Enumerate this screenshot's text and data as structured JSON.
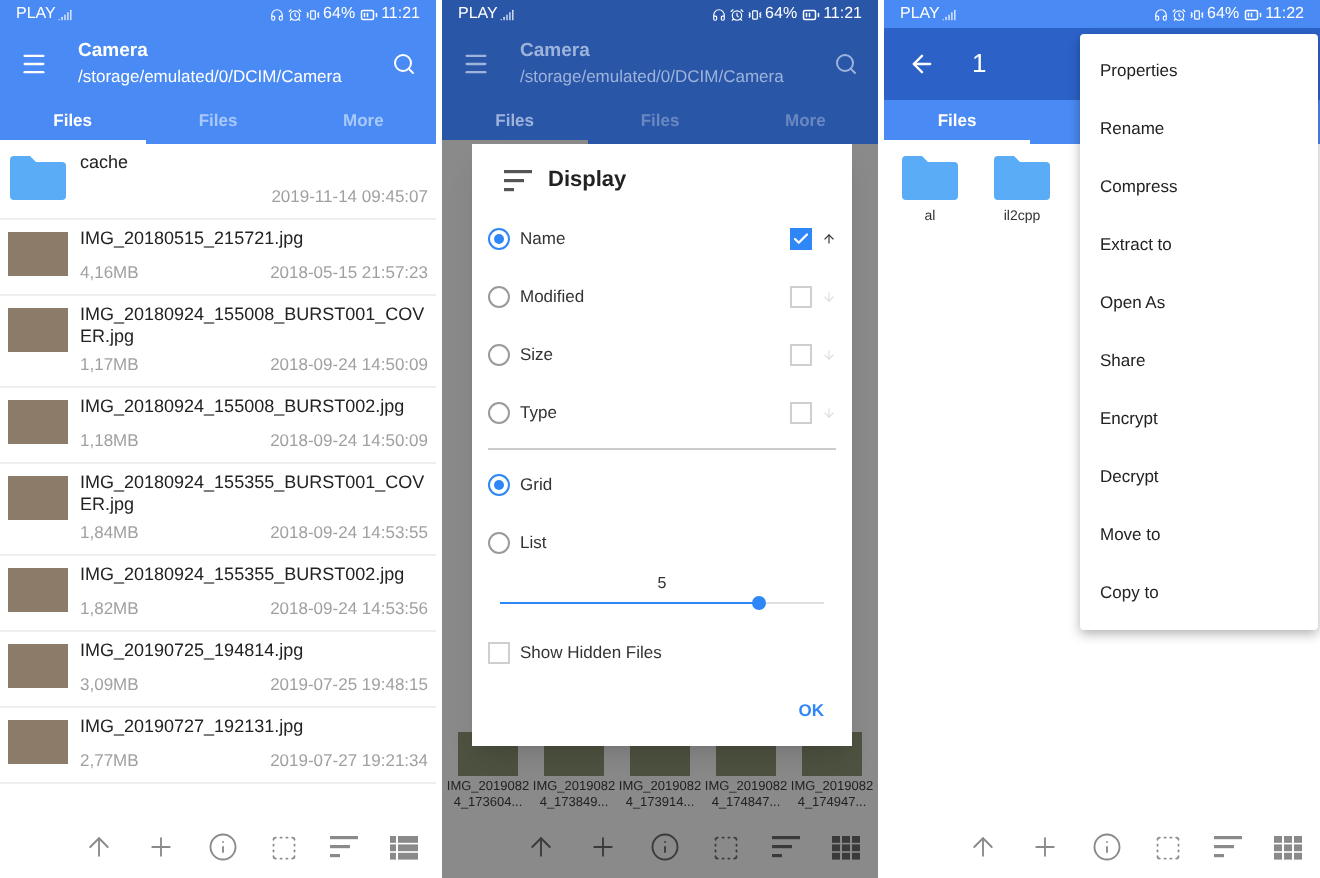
{
  "panels": [
    {
      "kind": "browser",
      "status_bar": {
        "carrier": "PLAY",
        "battery": "64%",
        "time": "11:21"
      },
      "header": {
        "kind": "browse",
        "title": "Camera",
        "path": "/storage/emulated/0/DCIM/Camera"
      },
      "tabs": [
        {
          "label": "Files",
          "selected": true
        },
        {
          "label": "Files",
          "selected": false
        },
        {
          "label": "More",
          "selected": false
        }
      ],
      "files": [
        {
          "kind": "folder",
          "name": "cache",
          "date": "2019-11-14 09:45:07"
        },
        {
          "kind": "image",
          "name": "IMG_20180515_215721.jpg",
          "size": "4,16MB",
          "date": "2018-05-15 21:57:23"
        },
        {
          "kind": "image",
          "name": "IMG_20180924_155008_BURST001_COVER.jpg",
          "size": "1,17MB",
          "date": "2018-09-24 14:50:09"
        },
        {
          "kind": "image",
          "name": "IMG_20180924_155008_BURST002.jpg",
          "size": "1,18MB",
          "date": "2018-09-24 14:50:09"
        },
        {
          "kind": "image",
          "name": "IMG_20180924_155355_BURST001_COVER.jpg",
          "size": "1,84MB",
          "date": "2018-09-24 14:53:55"
        },
        {
          "kind": "image",
          "name": "IMG_20180924_155355_BURST002.jpg",
          "size": "1,82MB",
          "date": "2018-09-24 14:53:56"
        },
        {
          "kind": "image",
          "name": "IMG_20190725_194814.jpg",
          "size": "3,09MB",
          "date": "2019-07-25 19:48:15"
        },
        {
          "kind": "image",
          "name": "IMG_20190727_192131.jpg",
          "size": "2,77MB",
          "date": "2019-07-27 19:21:34"
        }
      ],
      "toolbar": {
        "kind": "list"
      }
    },
    {
      "kind": "dialog",
      "status_bar": {
        "carrier": "PLAY",
        "battery": "64%",
        "time": "11:21"
      },
      "header": {
        "kind": "browse",
        "title": "Camera",
        "path": "/storage/emulated/0/DCIM/Camera"
      },
      "tabs": [
        {
          "label": "Files",
          "selected": true
        },
        {
          "label": "Files",
          "selected": false
        },
        {
          "label": "More",
          "selected": false
        }
      ],
      "grid_labels": [
        "IMG_20190824_173604...",
        "IMG_20190824_173849...",
        "IMG_20190824_173914...",
        "IMG_20190824_174847...",
        "IMG_20190824_174947..."
      ],
      "dialog": {
        "title": "Display",
        "sort_options": [
          {
            "label": "Name",
            "selected": true,
            "checked": true
          },
          {
            "label": "Modified",
            "selected": false,
            "checked": false
          },
          {
            "label": "Size",
            "selected": false,
            "checked": false
          },
          {
            "label": "Type",
            "selected": false,
            "checked": false
          }
        ],
        "view_options": [
          {
            "label": "Grid",
            "selected": true
          },
          {
            "label": "List",
            "selected": false
          }
        ],
        "columns": {
          "value": "5",
          "level": 0.8
        },
        "show_hidden": {
          "label": "Show Hidden Files",
          "checked": false
        },
        "ok": "OK"
      },
      "toolbar": {
        "kind": "grid"
      }
    },
    {
      "kind": "menu",
      "status_bar": {
        "carrier": "PLAY",
        "battery": "64%",
        "time": "11:22"
      },
      "header": {
        "kind": "select",
        "title": "1"
      },
      "tabs": [
        {
          "label": "Files",
          "selected": true
        }
      ],
      "folders": [
        {
          "name": "al"
        },
        {
          "name": "il2cpp"
        }
      ],
      "menu": [
        "Properties",
        "Rename",
        "Compress",
        "Extract to",
        "Open As",
        "Share",
        "Encrypt",
        "Decrypt",
        "Move to",
        "Copy to"
      ],
      "toolbar": {
        "kind": "grid"
      }
    }
  ]
}
